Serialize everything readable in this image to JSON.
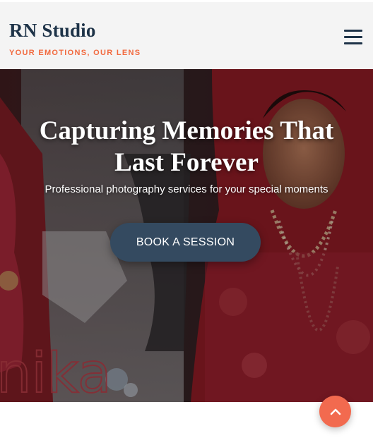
{
  "header": {
    "brand_name": "RN Studio",
    "tagline": "YOUR EMOTIONS, OUR LENS",
    "menu_icon": "hamburger-menu-icon"
  },
  "hero": {
    "title": "Capturing Memories That Last Forever",
    "subtitle": "Professional photography services for your special moments",
    "cta_label": "BOOK A SESSION",
    "background_watermark": "nika"
  },
  "scroll_top": {
    "icon": "chevron-up-icon"
  },
  "colors": {
    "brand_navy": "#1e3348",
    "accent_orange": "#f26a3f",
    "cta_background": "#344a60",
    "scroll_button": "#f26a4f"
  }
}
